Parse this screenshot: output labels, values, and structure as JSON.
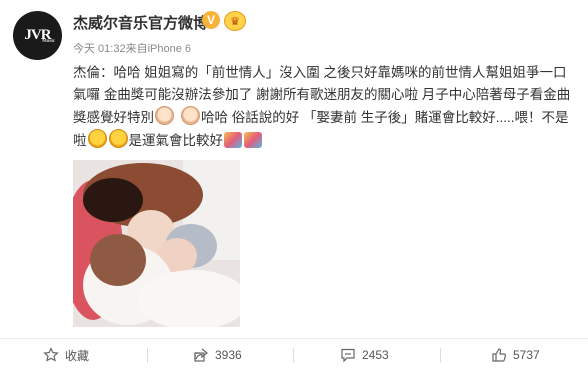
{
  "header": {
    "avatar_text": "JVR",
    "avatar_sub": "Music",
    "author": "杰威尔音乐官方微博",
    "verified_mark": "V",
    "member_icon": "crown-icon",
    "meta": "今天 01:32来自iPhone 6"
  },
  "post": {
    "seg1": "杰倫：哈哈 姐姐寫的「前世情人」沒入圍 之後只好靠媽咪的前世情人幫姐姐爭一口氣囉 金曲獎可能沒辦法參加了 謝謝所有歌迷朋友的關心啦 月子中心陪著母子看金曲獎感覺好特別",
    "seg2": "哈哈 俗話說的好 「娶妻前 生子後」賭運會比較好.....喂！不是啦",
    "seg3": "是運氣會比較好",
    "emoji_names": [
      "baby-emoji",
      "laugh-emoji",
      "party-emoji"
    ]
  },
  "actions": {
    "favorite_label": "收藏",
    "share_count": "3936",
    "comment_count": "2453",
    "like_count": "5737"
  },
  "colors": {
    "verified": "#f6b33a",
    "text": "#333333",
    "meta": "#8a8a8a"
  }
}
